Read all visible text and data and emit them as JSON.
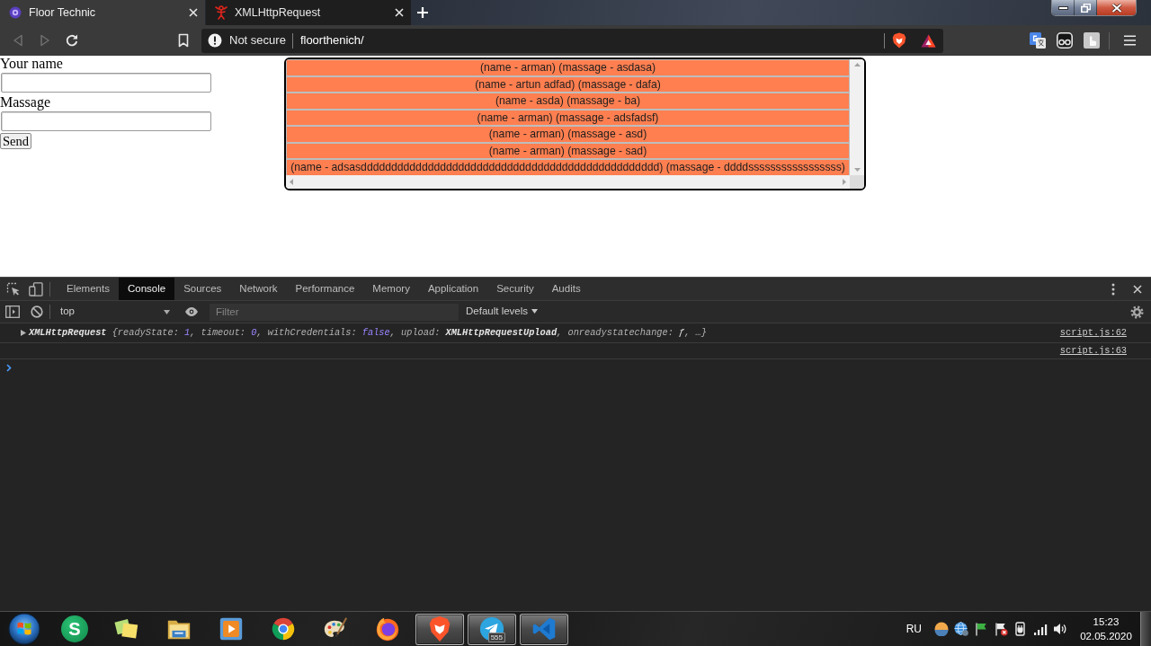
{
  "browser": {
    "tabs": [
      {
        "title": "Floor Technic",
        "selected": true
      },
      {
        "title": "XMLHttpRequest",
        "selected": false
      }
    ],
    "back_button": {
      "disabled": true
    },
    "forward_button": {
      "disabled": true
    },
    "address_bar": {
      "security_label": "Not secure",
      "url": "floorthenich/"
    }
  },
  "page": {
    "form": {
      "fields": [
        {
          "label": "Your name"
        },
        {
          "label": "Massage"
        }
      ],
      "submit_label": "Send"
    },
    "messages": [
      "(name - arman) (massage - asdasa)",
      "(name - artun adfad) (massage - dafa)",
      "(name - asda) (massage - ba)",
      "(name - arman) (massage - adsfadsf)",
      "(name - arman) (massage - asd)",
      "(name - arman) (massage - sad)",
      "(name - adsasddddddddddddddddddddddddddddddddddddddddddddddddd) (massage - ddddsssssssssssssssss)"
    ]
  },
  "devtools": {
    "tabs": [
      {
        "label": "Elements",
        "selected": false
      },
      {
        "label": "Console",
        "selected": true
      },
      {
        "label": "Sources",
        "selected": false
      },
      {
        "label": "Network",
        "selected": false
      },
      {
        "label": "Performance",
        "selected": false
      },
      {
        "label": "Memory",
        "selected": false
      },
      {
        "label": "Application",
        "selected": false
      },
      {
        "label": "Security",
        "selected": false
      },
      {
        "label": "Audits",
        "selected": false
      }
    ],
    "console_toolbar": {
      "context": "top",
      "filter_placeholder": "Filter",
      "levels_label": "Default levels"
    },
    "messages": [
      {
        "kind": "object",
        "expanded": false,
        "segments": [
          {
            "kind": "name",
            "text": "XMLHttpRequest"
          },
          {
            "kind": "plain",
            "text": " {readyState: "
          },
          {
            "kind": "number",
            "text": "1"
          },
          {
            "kind": "plain",
            "text": ", timeout: "
          },
          {
            "kind": "number",
            "text": "0"
          },
          {
            "kind": "plain",
            "text": ", withCredentials: "
          },
          {
            "kind": "boolean",
            "text": "false"
          },
          {
            "kind": "plain",
            "text": ", upload: "
          },
          {
            "kind": "name",
            "text": "XMLHttpRequestUpload"
          },
          {
            "kind": "plain",
            "text": ", onreadystatechange: "
          },
          {
            "kind": "function",
            "text": "ƒ"
          },
          {
            "kind": "plain",
            "text": ", …}"
          }
        ],
        "source": "script.js:62"
      },
      {
        "kind": "empty",
        "source": "script.js:63"
      }
    ]
  },
  "taskbar": {
    "apps": [
      {
        "running": false,
        "logo_text": "S"
      },
      {
        "running": false
      },
      {
        "running": false
      },
      {
        "running": false
      },
      {
        "running": false
      },
      {
        "running": false
      },
      {
        "running": false
      },
      {
        "running": true
      },
      {
        "running": true,
        "badge": "555"
      },
      {
        "running": true
      }
    ],
    "language": "RU",
    "time": "15:23",
    "date": "02.05.2020"
  }
}
